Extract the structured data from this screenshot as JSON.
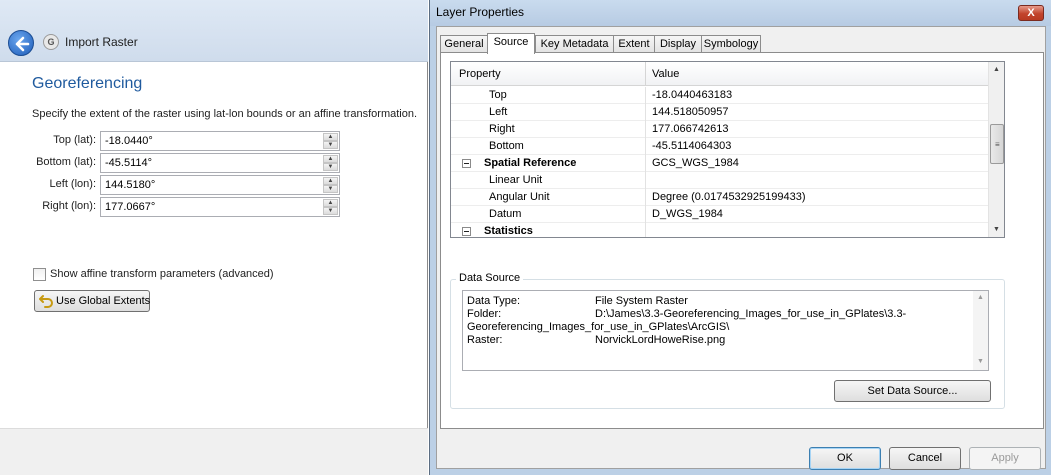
{
  "wizard": {
    "title": "Import Raster",
    "app_icon_glyph": "G",
    "section_title": "Georeferencing",
    "description": "Specify the extent of the raster using lat-lon bounds or an affine transformation.",
    "fields": [
      {
        "label": "Top (lat):",
        "value": "-18.0440°"
      },
      {
        "label": "Bottom (lat):",
        "value": "-45.5114°"
      },
      {
        "label": "Left (lon):",
        "value": "144.5180°"
      },
      {
        "label": "Right (lon):",
        "value": "177.0667°"
      }
    ],
    "advanced_label": "Show affine transform parameters (advanced)",
    "global_extents_label": "Use Global Extents",
    "accent_color": "#1f5a9e"
  },
  "dialog": {
    "title": "Layer Properties",
    "close_glyph": "X",
    "tabs": [
      "General",
      "Source",
      "Key Metadata",
      "Extent",
      "Display",
      "Symbology"
    ],
    "active_tab": "Source",
    "grid": {
      "col_property": "Property",
      "col_value": "Value",
      "rows": [
        {
          "name": "Top",
          "value": "-18.0440463183"
        },
        {
          "name": "Left",
          "value": "144.518050957"
        },
        {
          "name": "Right",
          "value": "177.066742613"
        },
        {
          "name": "Bottom",
          "value": "-45.5114064303"
        },
        {
          "name": "Spatial Reference",
          "value": "GCS_WGS_1984"
        },
        {
          "name": "Linear Unit",
          "value": ""
        },
        {
          "name": "Angular Unit",
          "value": "Degree (0.0174532925199433)"
        },
        {
          "name": "Datum",
          "value": "D_WGS_1984"
        },
        {
          "name": "Statistics",
          "value": ""
        }
      ]
    },
    "data_source": {
      "label": "Data Source",
      "data_type_key": "Data Type:",
      "data_type_value": "File System Raster",
      "folder_key": "Folder:",
      "folder_value": "D:\\James\\3.3-Georeferencing_Images_for_use_in_GPlates\\3.3-",
      "folder_value_cont": "Georeferencing_Images_for_use_in_GPlates\\ArcGIS\\",
      "raster_key": "Raster:",
      "raster_value": "NorvickLordHoweRise.png",
      "set_button": "Set Data Source..."
    },
    "ok_label": "OK",
    "cancel_label": "Cancel",
    "apply_label": "Apply"
  }
}
